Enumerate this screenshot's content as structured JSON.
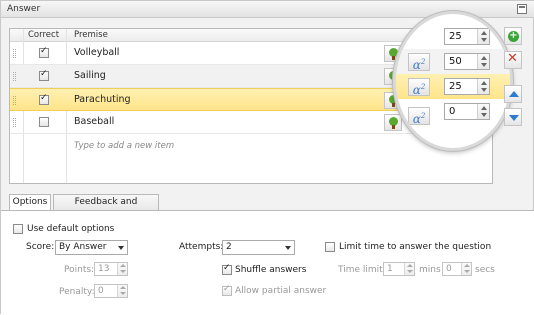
{
  "window": {
    "title": "Answer"
  },
  "grid": {
    "columns": {
      "correct": "Correct",
      "premise": "Premise"
    },
    "rows": [
      {
        "premise": "Volleyball",
        "correct": true,
        "value": "25",
        "selected": false
      },
      {
        "premise": "Sailing",
        "correct": true,
        "value": "50",
        "selected": false
      },
      {
        "premise": "Parachuting",
        "correct": true,
        "value": "25",
        "selected": true
      },
      {
        "premise": "Baseball",
        "correct": false,
        "value": "0",
        "selected": false
      }
    ],
    "new_item_placeholder": "Type to add a new item",
    "alpha_label": "α",
    "alpha_sup": "2"
  },
  "side_buttons": [
    "add-icon",
    "delete-icon",
    "move-up-icon",
    "move-down-icon"
  ],
  "tabs": [
    "Options",
    "Feedback and Branching"
  ],
  "options": {
    "use_default_options": {
      "label": "Use default options",
      "checked": false
    },
    "score": {
      "label": "Score:",
      "value": "By Answer"
    },
    "points": {
      "label": "Points:",
      "value": "13"
    },
    "penalty": {
      "label": "Penalty:",
      "value": "0"
    },
    "attempts": {
      "label": "Attempts:",
      "value": "2"
    },
    "shuffle": {
      "label": "Shuffle answers",
      "checked": true
    },
    "partial": {
      "label": "Allow partial answer",
      "checked": true
    },
    "time_limit_toggle": {
      "label": "Limit time to answer the question",
      "checked": false
    },
    "time_limit": {
      "label": "Time limit:",
      "mins_value": "1",
      "mins_label": "mins",
      "secs_value": "0",
      "secs_label": "secs"
    }
  },
  "colors": {
    "selected_row": "#ffe48a",
    "accent_blue": "#2b7bd0",
    "add_green": "#3aa43a",
    "delete_red": "#d33a2a"
  }
}
